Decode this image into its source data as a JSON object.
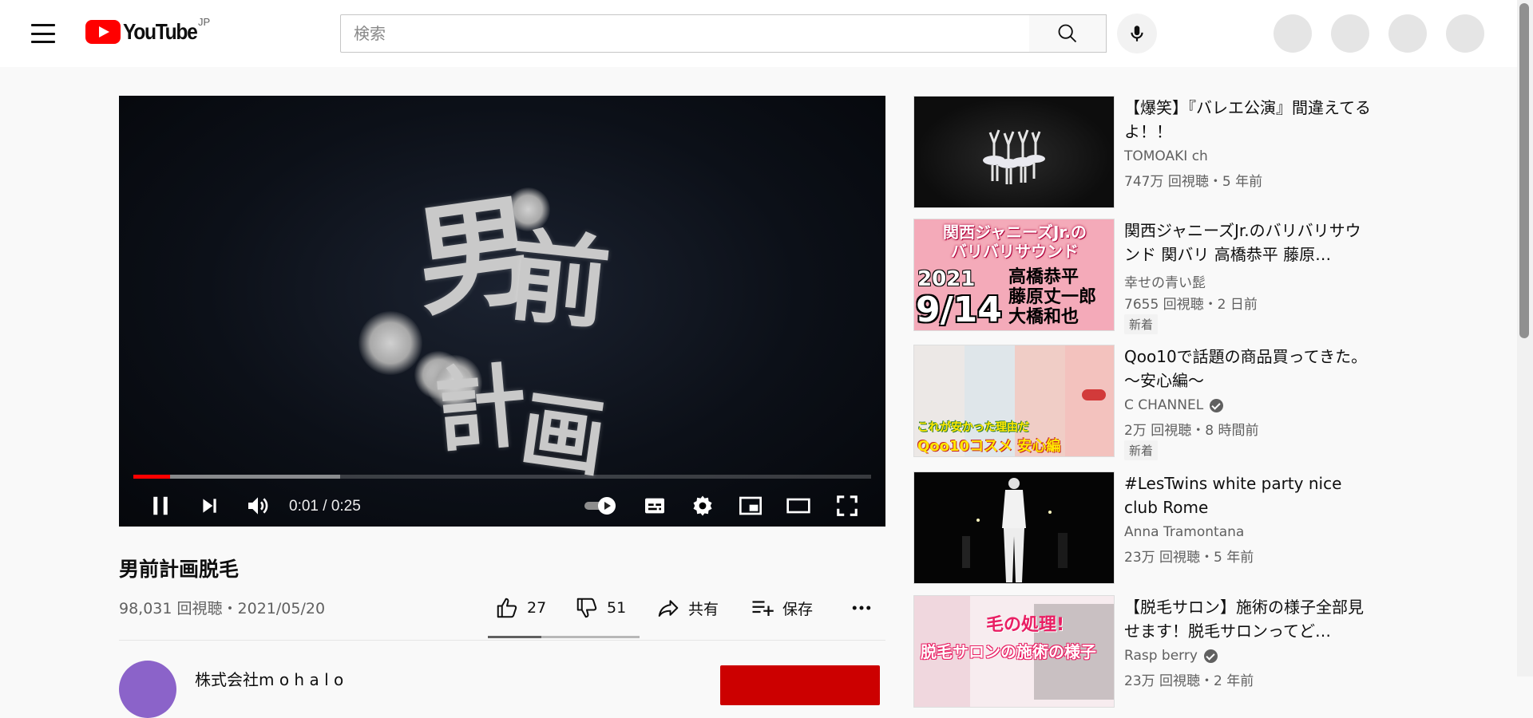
{
  "header": {
    "logo_text": "YouTube",
    "region": "JP",
    "search_placeholder": "検索",
    "icons": [
      "menu-icon",
      "search-icon",
      "mic-icon"
    ]
  },
  "player": {
    "time_display": "0:01 / 0:25",
    "played_fraction": 0.05,
    "buffered_fraction": 0.28,
    "calligraphy": [
      "男",
      "前",
      "計",
      "画"
    ],
    "icons": [
      "pause-icon",
      "next-icon",
      "volume-icon",
      "autoplay-toggle-icon",
      "subtitles-icon",
      "settings-icon",
      "miniplayer-icon",
      "theater-mode-icon",
      "fullscreen-icon"
    ]
  },
  "video": {
    "title": "男前計画脱毛",
    "meta": "98,031 回視聴・2021/05/20",
    "like_count": "27",
    "dislike_count": "51",
    "like_ratio": 0.35,
    "share_label": "共有",
    "save_label": "保存",
    "channel_name": "株式会社m o h a l o"
  },
  "recommendations": [
    {
      "title": "【爆笑】『バレエ公演』間違えてるよ！！",
      "channel": "TOMOAKI ch",
      "verified": false,
      "views": "747万 回視聴・5 年前",
      "badge": ""
    },
    {
      "title": "関西ジャニーズJr.のバリバリサウンド 関バリ 高橋恭平 藤原…",
      "channel": "幸せの青い髭",
      "verified": false,
      "views": "7655 回視聴・2 日前",
      "badge": "新着",
      "thumb_text": {
        "line1": "関西ジャニーズJr.の",
        "line2": "バリバリサウンド",
        "year": "2021",
        "date": "9/14",
        "names": [
          "高橋恭平",
          "藤原丈一郎",
          "大橋和也"
        ]
      }
    },
    {
      "title": "Qoo10で話題の商品買ってきた。～安心編～",
      "channel": "C CHANNEL",
      "verified": true,
      "views": "2万 回視聴・8 時間前",
      "badge": "新着",
      "thumb_text": {
        "line1": "これが安かった理由だ",
        "line2": "Qoo10コスメ 安心編"
      }
    },
    {
      "title": "#LesTwins white party nice club Rome",
      "channel": "Anna Tramontana",
      "verified": false,
      "views": "23万 回視聴・5 年前",
      "badge": ""
    },
    {
      "title": "【脱毛サロン】施術の様子全部見せます！脱毛サロンってど…",
      "channel": "Rasp berry",
      "verified": true,
      "views": "23万 回視聴・2 年前",
      "badge": "",
      "thumb_text": {
        "line1": "毛の処理!",
        "line2": "脱毛サロンの施術の様子"
      }
    }
  ],
  "colors": {
    "brand_red": "#ff0000",
    "progress_red": "#ff0000",
    "secondary_text": "#606060"
  }
}
